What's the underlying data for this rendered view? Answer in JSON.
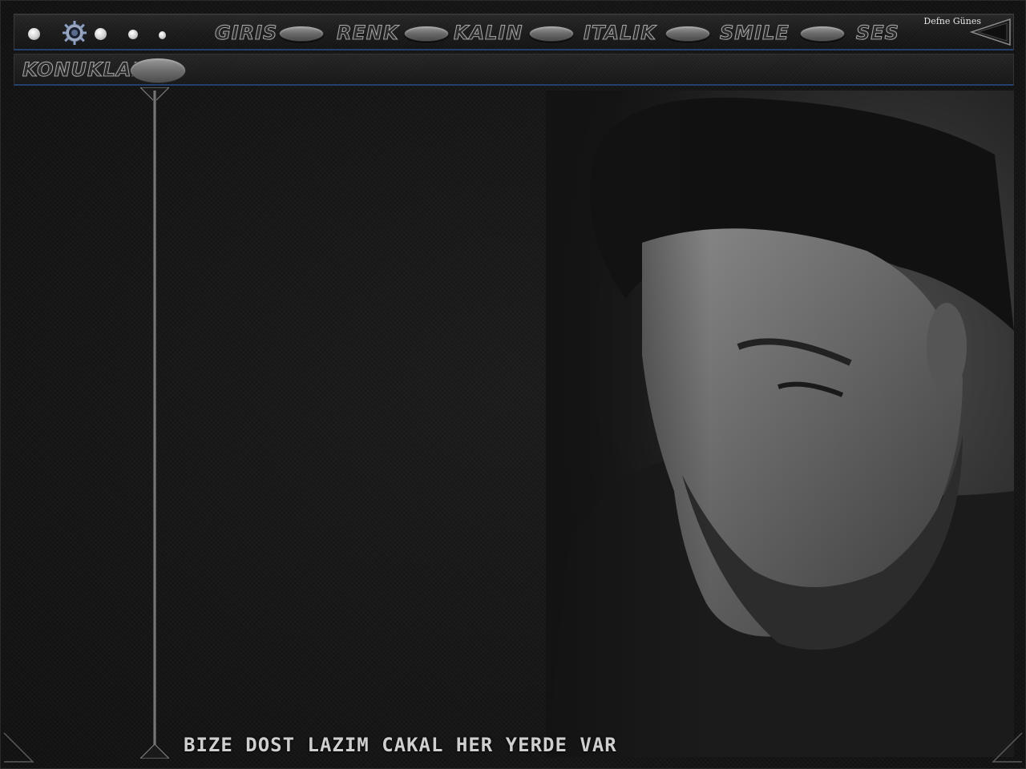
{
  "toolbar": {
    "menu": [
      {
        "label": "Giris"
      },
      {
        "label": "Renk"
      },
      {
        "label": "Kalin"
      },
      {
        "label": "Italik"
      },
      {
        "label": "Smile"
      },
      {
        "label": "Ses"
      }
    ],
    "user_name": "Defne Günes"
  },
  "subbar": {
    "label": "Konuklar"
  },
  "footer": {
    "text": "Bize DoSt Lazim Cakal Her YerDe Var"
  },
  "colors": {
    "background": "#131313",
    "accent_border": "#25406a",
    "text_light": "#cfcfcf"
  },
  "icons": {
    "toolbar": [
      "status-dot-icon",
      "gear-icon",
      "status-dot-icon",
      "status-dot-icon",
      "status-dot-icon"
    ],
    "corner": "triangle-arrow-icon"
  }
}
